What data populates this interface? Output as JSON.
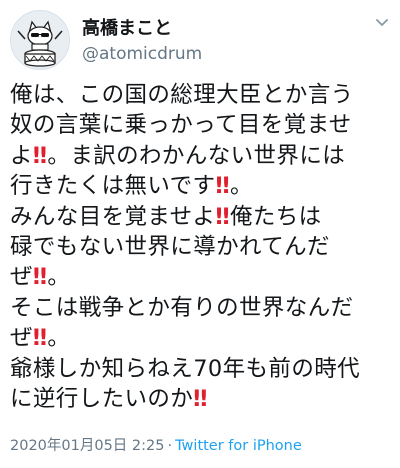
{
  "tweet": {
    "author": {
      "display_name": "高橋まこと",
      "handle": "@atomicdrum",
      "avatar_icon": "cat-drummer-avatar"
    },
    "menu_icon": "chevron-down-icon",
    "text_segments": [
      {
        "text": "俺は、この国の総理大臣とか言う\n奴の言葉に乗っかって目を覚ませ\nよ",
        "bang": false
      },
      {
        "text": "‼",
        "bang": true
      },
      {
        "text": "。ま訳のわかんない世界には\n行きたくは無いです",
        "bang": false
      },
      {
        "text": "‼",
        "bang": true
      },
      {
        "text": "。\nみんな目を覚ませよ",
        "bang": false
      },
      {
        "text": "‼",
        "bang": true
      },
      {
        "text": "俺たちは\n碌でもない世界に導かれてんだ\nぜ",
        "bang": false
      },
      {
        "text": "‼",
        "bang": true
      },
      {
        "text": "。\nそこは戦争とか有りの世界なんだ\nぜ",
        "bang": false
      },
      {
        "text": "‼",
        "bang": true
      },
      {
        "text": "。\n爺様しか知らねえ70年も前の時代\nに逆行したいのか",
        "bang": false
      },
      {
        "text": "‼",
        "bang": true
      }
    ],
    "timestamp": "2020年01月05日 2:25",
    "separator": "·",
    "source": "Twitter for iPhone",
    "colors": {
      "text": "#14171a",
      "secondary": "#657786",
      "link": "#1da1f2",
      "emoji_red": "#e0202e"
    }
  }
}
